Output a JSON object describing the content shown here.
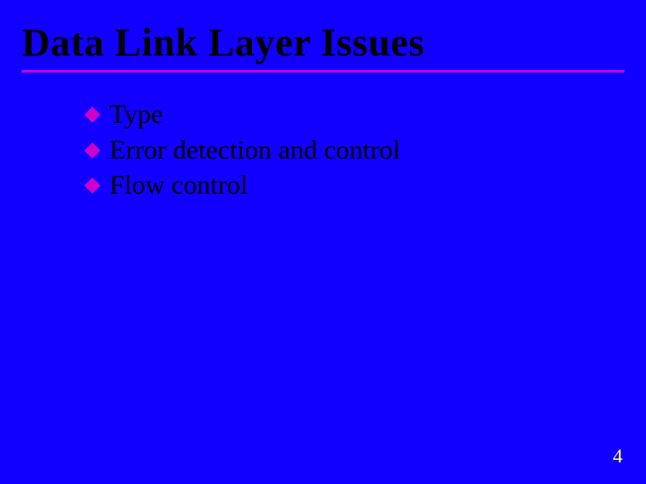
{
  "title": "Data Link Layer Issues",
  "bullets": [
    {
      "text": "Type"
    },
    {
      "text": "Error detection and control"
    },
    {
      "text": "Flow control"
    }
  ],
  "page_number": "4",
  "colors": {
    "background": "#1100ff",
    "underline": "#cc00cc",
    "bullet": "#cc00cc",
    "page_number": "#ffff66"
  }
}
